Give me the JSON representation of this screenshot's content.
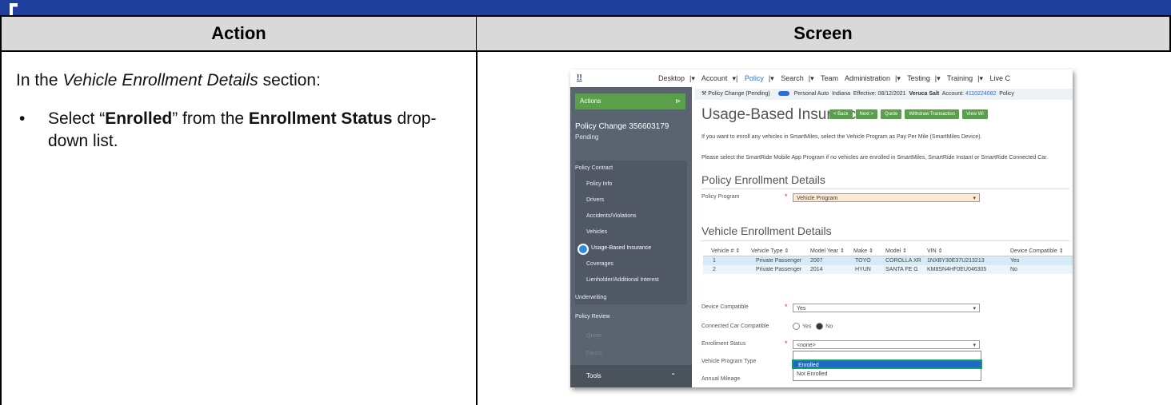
{
  "table": {
    "header_action": "Action",
    "header_screen": "Screen",
    "intro_prefix": "In the ",
    "intro_italic": "Vehicle Enrollment Details",
    "intro_suffix": " section:",
    "bullet_1": "Select “",
    "bullet_bold_1": "Enrolled",
    "bullet_2": "” from the ",
    "bullet_bold_2": "Enrollment Status",
    "bullet_3": " drop-down list."
  },
  "screenshot": {
    "nav": {
      "logo": "!!",
      "items": [
        "Desktop",
        "Account",
        "Policy",
        "Search",
        "Team",
        "Administration",
        "Testing",
        "Training",
        "Live C"
      ]
    },
    "sidebar": {
      "actions": "Actions",
      "policy_change": "Policy Change 356603179",
      "status": "Pending",
      "items": [
        "Policy Contract",
        "Policy Info",
        "Drivers",
        "Accidents/Violations",
        "Vehicles",
        "Usage-Based Insurance",
        "Coverages",
        "Lienholder/Additional Interest",
        "Underwriting",
        "Policy Review",
        "Quote",
        "Forms"
      ],
      "tools": "Tools"
    },
    "crumb": {
      "change": "Policy Change (Pending)",
      "product": "Personal Auto",
      "state": "Indiana",
      "effective": "Effective: 08/12/2021",
      "name": "Veruca Salt",
      "account": "Account:",
      "account_no": "4110224082",
      "policy": "Policy"
    },
    "title": "Usage-Based Insurance",
    "buttons": [
      "< Back",
      "Next >",
      "Quote",
      "Withdraw Transaction",
      "View Wi"
    ],
    "intro1": "If you want to enroll any vehicles in SmartMiles, select the Vehicle Program as Pay Per Mile (SmartMiles Device).",
    "intro2": "Please select the SmartRide Mobile App Program if no vehicles are enrolled in SmartMiles, SmartRide Instant or SmartRide Connected Car.",
    "policy_section": "Policy Enrollment Details",
    "policy_program_label": "Policy Program",
    "policy_program_value": "Vehicle Program",
    "vehicle_section": "Vehicle Enrollment Details",
    "vehicle_table": {
      "columns": [
        "Vehicle # ⇕",
        "Vehicle Type ⇕",
        "Model Year ⇕",
        "Make ⇕",
        "Model ⇕",
        "VIN ⇕",
        "Device Compatible ⇕"
      ],
      "rows": [
        [
          "1",
          "Private Passenger",
          "2007",
          "TOYO",
          "COROLLA XR",
          "1NXBY30E37U213213",
          "Yes"
        ],
        [
          "2",
          "Private Passenger",
          "2014",
          "HYUN",
          "SANTA FE G",
          "KM8SN4HF0EU046305",
          "No"
        ]
      ]
    },
    "device_compatible_label": "Device Compatible",
    "device_compatible_value": "Yes",
    "connected_car_label": "Connected Car Compatible",
    "radio_yes": "Yes",
    "radio_no": "No",
    "enrollment_status_label": "Enrollment Status",
    "enrollment_status_value": "<none>",
    "vehicle_program_label": "Vehicle Program Type",
    "annual_mileage_label": "Annual Mileage",
    "dropdown_options": [
      "Enrolled",
      "Not Enrolled"
    ]
  }
}
